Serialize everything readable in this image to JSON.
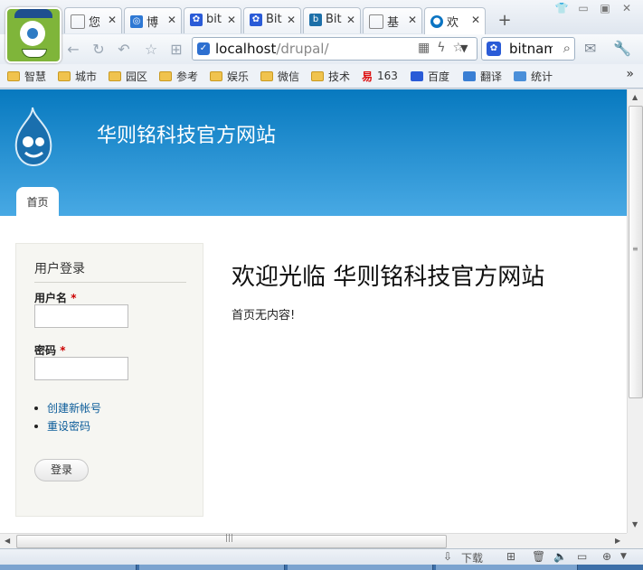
{
  "browser": {
    "tabs": [
      {
        "label": "您",
        "icon": "page-icon"
      },
      {
        "label": "博",
        "icon": "blog-icon"
      },
      {
        "label": "bit",
        "icon": "baidu-paw-icon"
      },
      {
        "label": "Bit",
        "icon": "baidu-paw-icon"
      },
      {
        "label": "Bit",
        "icon": "bing-icon"
      },
      {
        "label": "基",
        "icon": "page-icon"
      },
      {
        "label": "欢",
        "icon": "drupal-icon",
        "active": true
      }
    ],
    "tab_close": "✕",
    "new_tab": "+",
    "url_host": "localhost",
    "url_path": "/drupal/",
    "search_text": "bitnam",
    "search_engine_icon": "baidu-paw-icon"
  },
  "bookmarks": [
    {
      "label": "智慧",
      "icon": "folder-icon"
    },
    {
      "label": "城市",
      "icon": "folder-icon"
    },
    {
      "label": "园区",
      "icon": "folder-icon"
    },
    {
      "label": "参考",
      "icon": "folder-icon"
    },
    {
      "label": "娱乐",
      "icon": "folder-icon"
    },
    {
      "label": "微信",
      "icon": "folder-icon"
    },
    {
      "label": "技术",
      "icon": "folder-icon"
    },
    {
      "label": "163",
      "icon": "netease-icon"
    },
    {
      "label": "百度",
      "icon": "baidu-paw-icon"
    },
    {
      "label": "翻译",
      "icon": "translate-icon"
    },
    {
      "label": "统计",
      "icon": "stats-icon"
    }
  ],
  "bookmarks_more": "»",
  "site": {
    "name": "华则铭科技官方网站",
    "nav": {
      "home": "首页"
    }
  },
  "login_block": {
    "title": "用户登录",
    "username_label": "用户名",
    "password_label": "密码",
    "required_mark": "*",
    "links": [
      "创建新帐号",
      "重设密码"
    ],
    "submit": "登录"
  },
  "main": {
    "title": "欢迎光临 华则铭科技官方网站",
    "body": "首页无内容!"
  },
  "statusbar": {
    "download": "下载"
  },
  "colors": {
    "header_top": "#0779bf",
    "header_bottom": "#48a9e4",
    "link": "#0a5b99",
    "required": "#cc0000"
  }
}
